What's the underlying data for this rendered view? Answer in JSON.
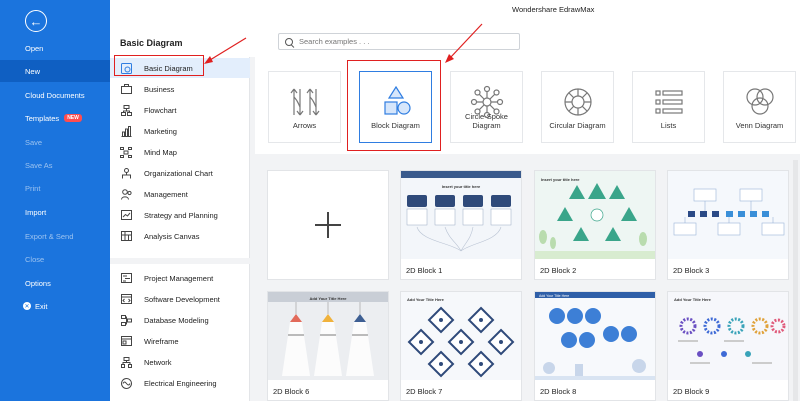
{
  "app": {
    "title": "Wondershare EdrawMax"
  },
  "nav": {
    "back": "←",
    "items": [
      {
        "label": "Open"
      },
      {
        "label": "New"
      },
      {
        "label": "Cloud Documents"
      },
      {
        "label": "Templates",
        "badge": "NEW"
      },
      {
        "label": "Save"
      },
      {
        "label": "Save As"
      },
      {
        "label": "Print"
      },
      {
        "label": "Import"
      },
      {
        "label": "Export & Send"
      },
      {
        "label": "Close"
      },
      {
        "label": "Options"
      },
      {
        "label": "Exit"
      }
    ]
  },
  "section": {
    "title": "Basic Diagram"
  },
  "search": {
    "placeholder": "Search examples . . ."
  },
  "categories": [
    {
      "label": "Basic Diagram",
      "icon": "basic-diagram-icon"
    },
    {
      "label": "Business",
      "icon": "briefcase-icon"
    },
    {
      "label": "Flowchart",
      "icon": "flowchart-icon"
    },
    {
      "label": "Marketing",
      "icon": "bar-chart-icon"
    },
    {
      "label": "Mind Map",
      "icon": "mind-map-icon"
    },
    {
      "label": "Organizational Chart",
      "icon": "org-chart-icon"
    },
    {
      "label": "Management",
      "icon": "management-icon"
    },
    {
      "label": "Strategy and Planning",
      "icon": "strategy-icon"
    },
    {
      "label": "Analysis Canvas",
      "icon": "canvas-icon"
    },
    {
      "label": "Project Management",
      "icon": "project-icon"
    },
    {
      "label": "Software Development",
      "icon": "software-icon"
    },
    {
      "label": "Database Modeling",
      "icon": "database-icon"
    },
    {
      "label": "Wireframe",
      "icon": "wireframe-icon"
    },
    {
      "label": "Network",
      "icon": "network-icon"
    },
    {
      "label": "Electrical Engineering",
      "icon": "electrical-icon"
    }
  ],
  "types": [
    {
      "label": "Arrows"
    },
    {
      "label": "Block Diagram"
    },
    {
      "label": "Circle-Spoke Diagram"
    },
    {
      "label": "Circular Diagram"
    },
    {
      "label": "Lists"
    },
    {
      "label": "Venn Diagram"
    }
  ],
  "examples": [
    {
      "label": "2D Block 1",
      "title": "Insert your title here"
    },
    {
      "label": "2D Block 2",
      "title": "Insert your title here"
    },
    {
      "label": "2D Block 3",
      "title": ""
    },
    {
      "label": "2D Block 6",
      "title": "Add Your Title Here"
    },
    {
      "label": "2D Block 7",
      "title": "Add Your Title Here"
    },
    {
      "label": "2D Block 8",
      "title": "Add Your Title Here"
    },
    {
      "label": "2D Block 9",
      "title": "Add Your Title Here"
    }
  ],
  "colors": {
    "nav_bg": "#1b74dd",
    "accent": "#2f7de1",
    "highlight": "#e02020",
    "badge": "#ff4d4f"
  }
}
